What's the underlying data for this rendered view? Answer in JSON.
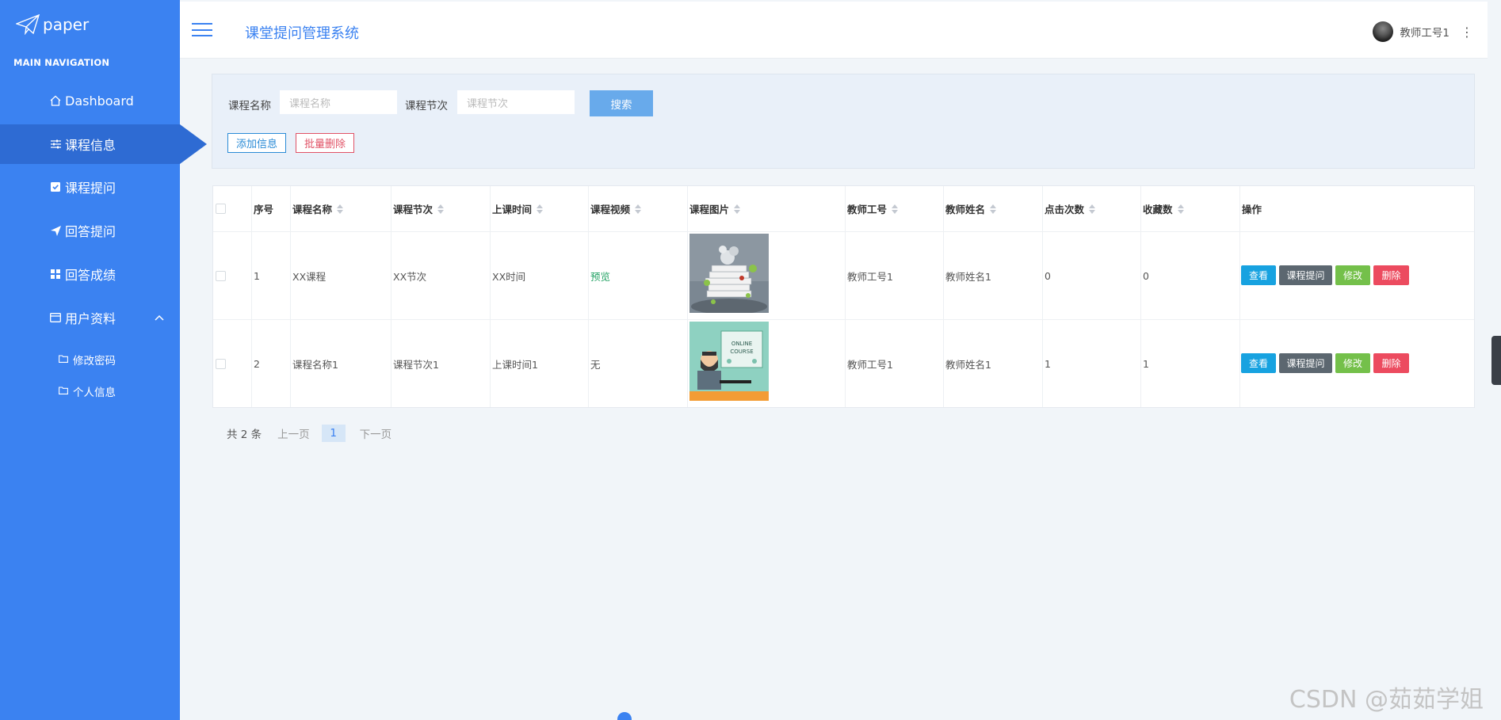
{
  "sidebar": {
    "logo_text": "paper",
    "nav_title": "MAIN NAVIGATION",
    "items": [
      {
        "label": "Dashboard",
        "icon": "home-icon"
      },
      {
        "label": "课程信息",
        "icon": "sliders-icon"
      },
      {
        "label": "课程提问",
        "icon": "checkbox-icon"
      },
      {
        "label": "回答提问",
        "icon": "send-icon"
      },
      {
        "label": "回答成绩",
        "icon": "grid-icon"
      },
      {
        "label": "用户资料",
        "icon": "card-icon"
      }
    ],
    "subitems": [
      {
        "label": "修改密码",
        "icon": "folder-icon"
      },
      {
        "label": "个人信息",
        "icon": "folder-icon"
      }
    ],
    "accent_color": "#3b82f1"
  },
  "header": {
    "title": "课堂提问管理系统",
    "user_name": "教师工号1"
  },
  "search": {
    "field1_label": "课程名称",
    "field1_placeholder": "课程名称",
    "field2_label": "课程节次",
    "field2_placeholder": "课程节次",
    "search_button": "搜索",
    "add_button": "添加信息",
    "batch_delete_button": "批量删除"
  },
  "table": {
    "columns": [
      "序号",
      "课程名称",
      "课程节次",
      "上课时间",
      "课程视频",
      "课程图片",
      "教师工号",
      "教师姓名",
      "点击次数",
      "收藏数",
      "操作"
    ],
    "rows": [
      {
        "index": "1",
        "name": "XX课程",
        "section": "XX节次",
        "time": "XX时间",
        "video": "预览",
        "image": "books-image",
        "teacher_id": "教师工号1",
        "teacher_name": "教师姓名1",
        "clicks": "0",
        "favorites": "0"
      },
      {
        "index": "2",
        "name": "课程名称1",
        "section": "课程节次1",
        "time": "上课时间1",
        "video": "无",
        "image": "online-course-image",
        "teacher_id": "教师工号1",
        "teacher_name": "教师姓名1",
        "clicks": "1",
        "favorites": "1"
      }
    ],
    "actions": {
      "view": "查看",
      "ask": "课程提问",
      "edit": "修改",
      "delete": "删除"
    }
  },
  "pager": {
    "total": "共 2 条",
    "prev": "上一页",
    "current": "1",
    "next": "下一页"
  },
  "watermark": "CSDN @茹茹学姐"
}
